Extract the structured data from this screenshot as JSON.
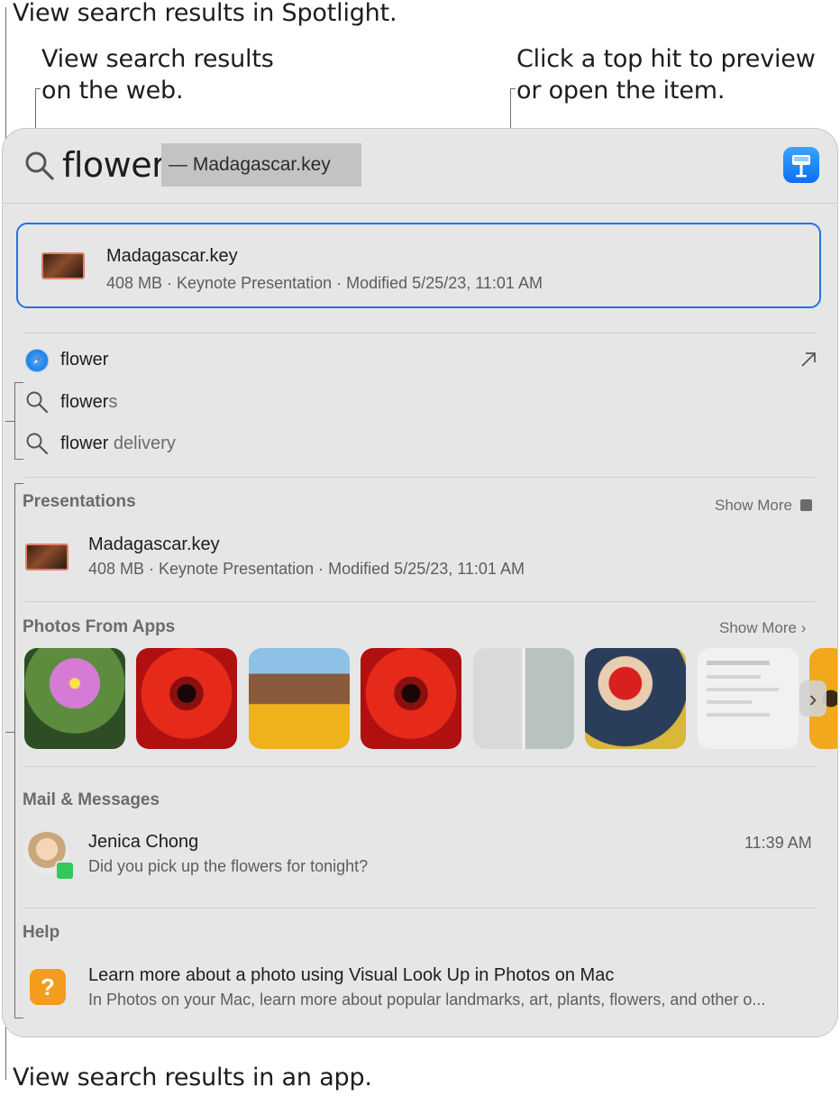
{
  "callouts": {
    "spotlight": "View search results in Spotlight.",
    "web": "View search results\non the web.",
    "top_hit": "Click a top hit to preview\nor open the item.",
    "app": "View search results in an app."
  },
  "search": {
    "query": "flower",
    "completion": "— Madagascar.key",
    "search_icon": "search-icon",
    "app_icon": "keynote-icon"
  },
  "top_hit": {
    "title": "Madagascar.key",
    "subtitle": "408 MB · Keynote Presentation · Modified 5/25/23, 11:01 AM"
  },
  "suggestions": [
    {
      "icon": "safari-icon",
      "typed": "flower",
      "rest": "",
      "action_icon": "open-arrow-icon"
    },
    {
      "icon": "search-icon",
      "typed": "flower",
      "rest": "s"
    },
    {
      "icon": "search-icon",
      "typed": "flower",
      "rest": " delivery"
    }
  ],
  "presentations": {
    "header": "Presentations",
    "show_more": "Show More",
    "item": {
      "title": "Madagascar.key",
      "subtitle": "408 MB · Keynote Presentation · Modified 5/25/23, 11:01 AM"
    }
  },
  "photos": {
    "header": "Photos From Apps",
    "show_more": "Show More ›"
  },
  "mail": {
    "header": "Mail & Messages",
    "item": {
      "name": "Jenica Chong",
      "message": "Did you pick up the flowers for tonight?",
      "time": "11:39 AM"
    }
  },
  "help": {
    "header": "Help",
    "item": {
      "title": "Learn more about a photo using Visual Look Up in Photos on Mac",
      "subtitle": "In Photos on your Mac, learn more about popular landmarks, art, plants, flowers, and other o..."
    }
  },
  "colors": {
    "accent": "#1f74e6",
    "panel_bg": "#e6e6e6"
  }
}
